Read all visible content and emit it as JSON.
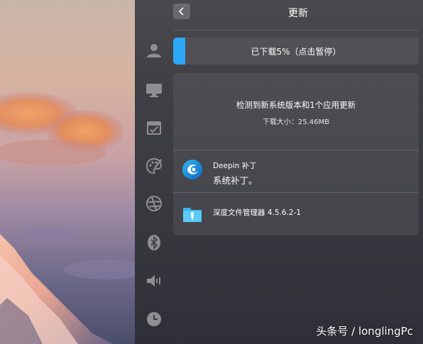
{
  "header": {
    "title": "更新"
  },
  "sidebar": {
    "items": [
      {
        "icon": "user-accounts-icon"
      },
      {
        "icon": "display-icon"
      },
      {
        "icon": "date-time-icon"
      },
      {
        "icon": "personalization-icon"
      },
      {
        "icon": "network-icon"
      },
      {
        "icon": "bluetooth-icon"
      },
      {
        "icon": "sound-icon"
      },
      {
        "icon": "time-icon"
      }
    ]
  },
  "progress": {
    "percent": 5,
    "label": "已下载5%（点击暂停）",
    "color": "#2ca7f8"
  },
  "summary": {
    "title": "检测到新系统版本和1个应用更新",
    "size_label": "下载大小：25.46MB"
  },
  "updates": [
    {
      "name": "Deepin 补丁",
      "description": "系统补丁。",
      "icon": "deepin-logo-icon"
    },
    {
      "name": "深度文件管理器 4.5.6.2-1",
      "icon": "file-manager-icon"
    }
  ],
  "watermark": "头条号 / longlingPc"
}
